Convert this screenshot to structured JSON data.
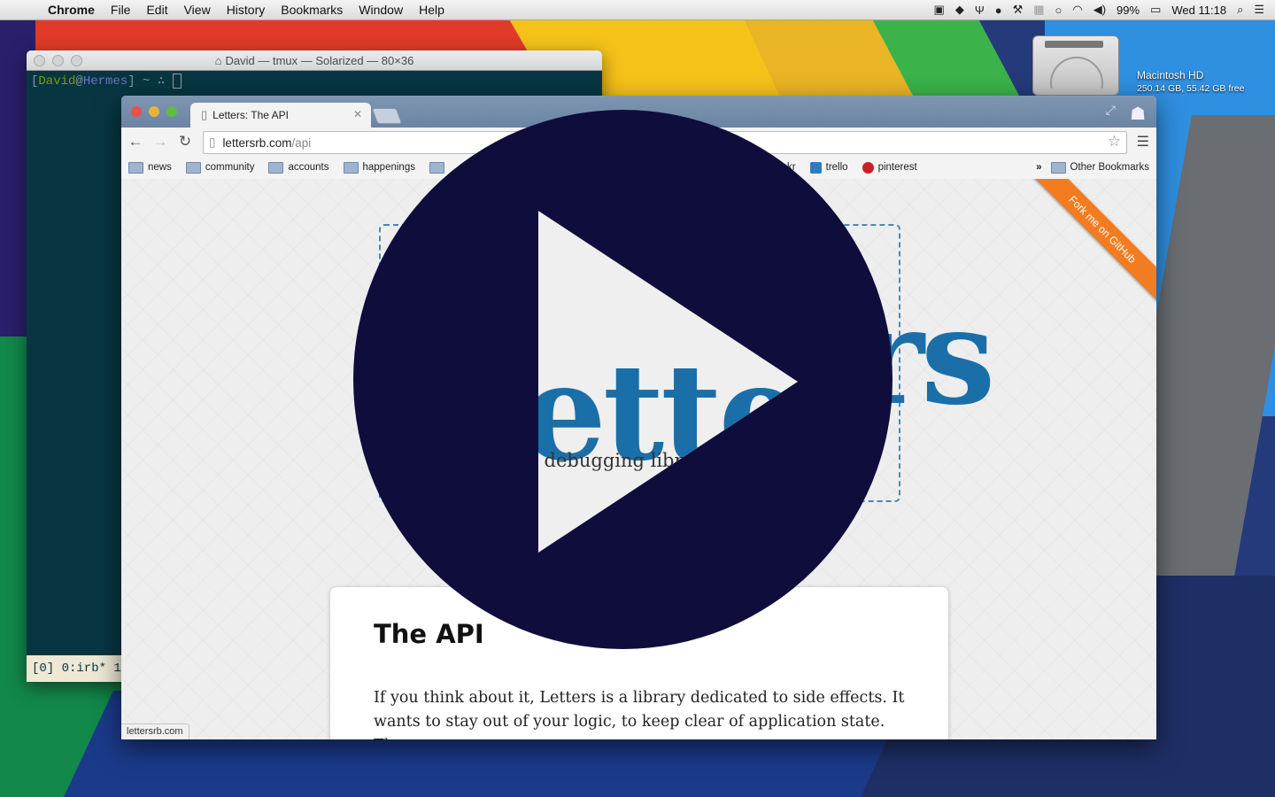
{
  "menubar": {
    "app": "Chrome",
    "items": [
      "File",
      "Edit",
      "View",
      "History",
      "Bookmarks",
      "Window",
      "Help"
    ],
    "battery": "99%",
    "clock": "Wed 11:18"
  },
  "desktop": {
    "disk_name": "Macintosh HD",
    "disk_info": "250.14 GB, 55.42 GB free"
  },
  "terminal": {
    "title": "David — tmux — Solarized — 80×36",
    "prompt_user": "David",
    "prompt_at": "@",
    "prompt_host": "Hermes",
    "prompt_rest": " ~ ∴ ",
    "status": "[0] 0:irb* 1:"
  },
  "browser": {
    "tab_title": "Letters: The API",
    "url_host": "lettersrb.com",
    "url_path": "/api",
    "bookmarks": [
      "news",
      "community",
      "accounts",
      "happenings"
    ],
    "bookmark_partial": "flickr",
    "bookmark_trello": "trello",
    "bookmark_pinterest": "pinterest",
    "other_bookmarks": "Other Bookmarks",
    "status_url": "lettersrb.com"
  },
  "page": {
    "logo": "Letters",
    "tagline_partial": "y debugging libr",
    "fork_ribbon": "Fork me on GitHub",
    "heading": "The API",
    "paragraph": "If you think about it, Letters is a library dedicated to side effects. It wants to stay out of your logic, to keep clear of application state. The"
  },
  "overlay": {
    "icon": "play-icon",
    "bg_color": "#0f0d3c"
  }
}
